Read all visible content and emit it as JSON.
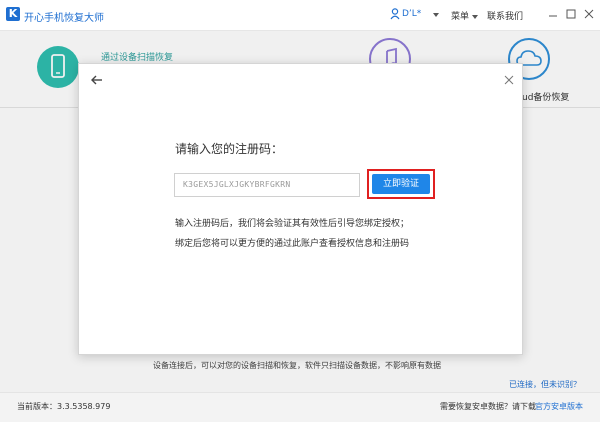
{
  "app": {
    "logo_letter": "K",
    "title": "开心手机恢复大师"
  },
  "header": {
    "username": "D’L*",
    "menu_label": "菜单",
    "feedback_label": "联系我们"
  },
  "modes": {
    "device_scan_label": "通过设备扫描恢复",
    "icloud_label": "ud备份恢复"
  },
  "dialog": {
    "prompt": "请输入您的注册码：",
    "code_value": "K3GEX5JGLXJGKYBRFGKRN",
    "verify_button": "立即验证",
    "info_line1": "输入注册码后，我们将会验证其有效性后引导您绑定授权；",
    "info_line2": "绑定后您将可以更方便的通过此账户查看授权信息和注册码"
  },
  "main": {
    "description": "设备连接后，可以对您的设备扫描和恢复，软件只扫描设备数据，不影响原有数据",
    "connected_link": "已连接，但未识别？"
  },
  "footer": {
    "version_label": "当前版本：3.3.5358.979",
    "android_question": "需要恢复安卓数据？请下载",
    "android_link": "官方安卓版本"
  },
  "colors": {
    "brand": "#1f6fd1",
    "accent_teal": "#2fbfb0",
    "button_blue": "#1f86e8",
    "highlight_red": "#e02020"
  }
}
